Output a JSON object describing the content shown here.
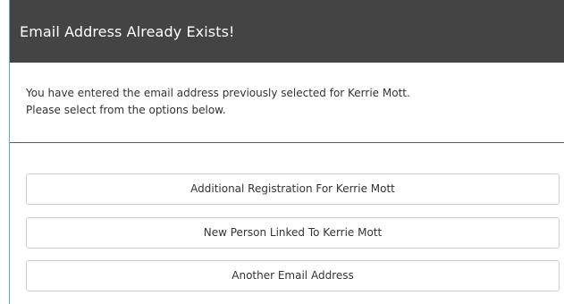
{
  "dialog": {
    "title": "Email Address Already Exists!",
    "message_line_1": "You have entered the email address previously selected for Kerrie Mott.",
    "message_line_2": "Please select from the options below."
  },
  "options": [
    {
      "label": "Additional Registration For Kerrie Mott"
    },
    {
      "label": "New Person Linked To Kerrie Mott"
    },
    {
      "label": "Another Email Address"
    }
  ],
  "colors": {
    "header_background": "#444444",
    "header_text": "#ffffff",
    "left_accent": "#6fa3d3",
    "divider": "#5a5a5a",
    "button_border": "#cfcfcf"
  }
}
